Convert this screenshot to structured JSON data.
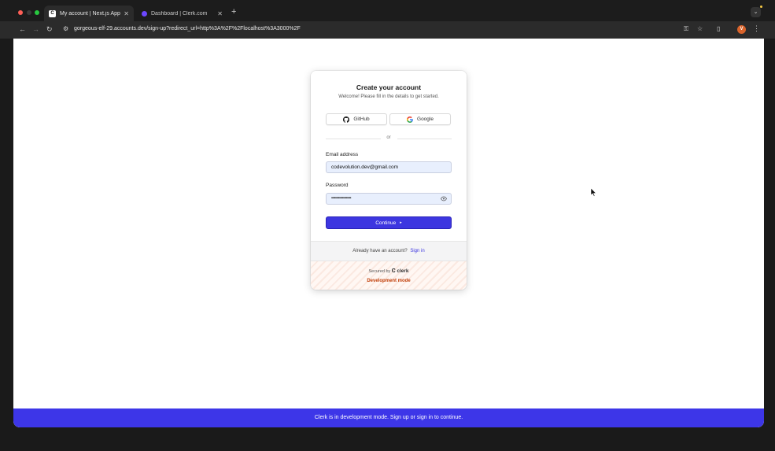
{
  "browser": {
    "tabs": [
      {
        "title": "My account | Next.js App",
        "favicon": "C",
        "active": true
      },
      {
        "title": "Dashboard | Clerk.com",
        "favicon": "clerk",
        "active": false
      }
    ],
    "new_tab_icon": "+",
    "url": "gorgeous-elf-29.accounts.dev/sign-up?redirect_url=http%3A%2F%2Flocalhost%3A3000%2F",
    "profile_initial": "V"
  },
  "card": {
    "title": "Create your account",
    "subtitle": "Welcome! Please fill in the details to get started.",
    "github_label": "GitHub",
    "google_label": "Google",
    "divider_text": "or",
    "email_label": "Email address",
    "email_value": "codevolution.dev@gmail.com",
    "password_label": "Password",
    "password_value": "••••••••••••••••••••",
    "continue_label": "Continue",
    "footer_text": "Already have an account?",
    "signin_link": "Sign in",
    "secured_by": "Secured by",
    "clerk_brand": "clerk",
    "dev_mode": "Development mode"
  },
  "banner": {
    "text": "Clerk is in development mode. Sign up or sign in to continue."
  },
  "colors": {
    "primary": "#3d36e0",
    "dev_mode": "#c2410c",
    "banner": "#3d36e8"
  }
}
